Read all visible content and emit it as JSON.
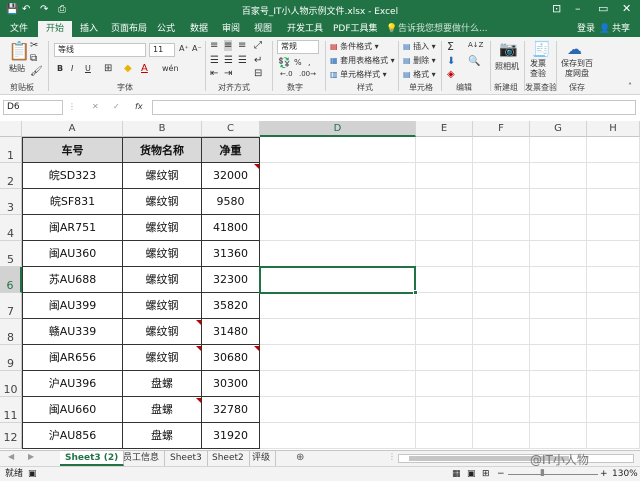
{
  "window": {
    "title": "百家号_IT小人物示例文件.xlsx - Excel",
    "qa_save": "💾",
    "qa_undo": "↶",
    "qa_redo": "↷",
    "qa_print": "⎙",
    "minimize": "–",
    "restore": "▭",
    "close": "✕",
    "ribbon_toggle": "⊡"
  },
  "menu": {
    "tabs": [
      "文件",
      "开始",
      "插入",
      "页面布局",
      "公式",
      "数据",
      "审阅",
      "视图",
      "开发工具",
      "PDF工具集"
    ],
    "active_tab": "开始",
    "tell_me": "告诉我您想要做什么...",
    "login": "登录",
    "share": "共享"
  },
  "ribbon": {
    "clipboard": {
      "paste": "粘贴",
      "label": "剪贴板"
    },
    "font": {
      "name": "等线",
      "size": "11",
      "bold": "B",
      "italic": "I",
      "underline": "U",
      "grow": "A⁺",
      "shrink": "A⁻",
      "wen": "wén",
      "label": "字体"
    },
    "alignment": {
      "label": "对齐方式"
    },
    "number": {
      "format": "常规",
      "percent": "%",
      "comma": ",",
      "label": "数字"
    },
    "styles": {
      "conditional": "条件格式",
      "table": "套用表格格式",
      "cell": "单元格样式",
      "label": "样式"
    },
    "cells": {
      "insert": "插入",
      "delete": "删除",
      "format": "格式",
      "label": "单元格"
    },
    "editing": {
      "sum": "Σ",
      "sort": "A↓Z",
      "label": "编辑"
    },
    "new_group": {
      "camera": "照相机",
      "label": "新建组"
    },
    "invoice": {
      "check": "发票查验",
      "label": "发票查验"
    },
    "save": {
      "cloud": "保存到百度网盘",
      "label": "保存"
    }
  },
  "formula_bar": {
    "name_box": "D6",
    "cancel": "✕",
    "enter": "✓",
    "fx": "fx",
    "value": ""
  },
  "columns": [
    "A",
    "B",
    "C",
    "D",
    "E",
    "F",
    "G",
    "H"
  ],
  "selected_column": "D",
  "selected_row": "6",
  "table": {
    "headers": [
      "车号",
      "货物名称",
      "净重"
    ],
    "rows": [
      {
        "row": "2",
        "plate": "皖SD323",
        "goods": "螺纹钢",
        "weight": "32000"
      },
      {
        "row": "3",
        "plate": "皖SF831",
        "goods": "螺纹钢",
        "weight": "9580"
      },
      {
        "row": "4",
        "plate": "闽AR751",
        "goods": "螺纹钢",
        "weight": "41800"
      },
      {
        "row": "5",
        "plate": "闽AU360",
        "goods": "螺纹钢",
        "weight": "31360"
      },
      {
        "row": "6",
        "plate": "苏AU688",
        "goods": "螺纹钢",
        "weight": "32300"
      },
      {
        "row": "7",
        "plate": "闽AU399",
        "goods": "螺纹钢",
        "weight": "35820"
      },
      {
        "row": "8",
        "plate": "赣AU339",
        "goods": "螺纹钢",
        "weight": "31480"
      },
      {
        "row": "9",
        "plate": "闽AR656",
        "goods": "螺纹钢",
        "weight": "30680"
      },
      {
        "row": "10",
        "plate": "沪AU396",
        "goods": "盘螺",
        "weight": "30300"
      },
      {
        "row": "11",
        "plate": "闽AU660",
        "goods": "盘螺",
        "weight": "32780"
      },
      {
        "row": "12",
        "plate": "沪AU856",
        "goods": "盘螺",
        "weight": "31920"
      }
    ]
  },
  "sheets": [
    "Sheet3 (2)",
    "员工信息",
    "Sheet3",
    "Sheet2",
    "评级"
  ],
  "active_sheet": "Sheet3 (2)",
  "status": {
    "ready": "就绪",
    "zoom": "130%",
    "watermark": "@IT小人物"
  },
  "colors": {
    "excel_green": "#217346",
    "header_fill": "#d9d9d9",
    "comment_red": "#c00000"
  }
}
